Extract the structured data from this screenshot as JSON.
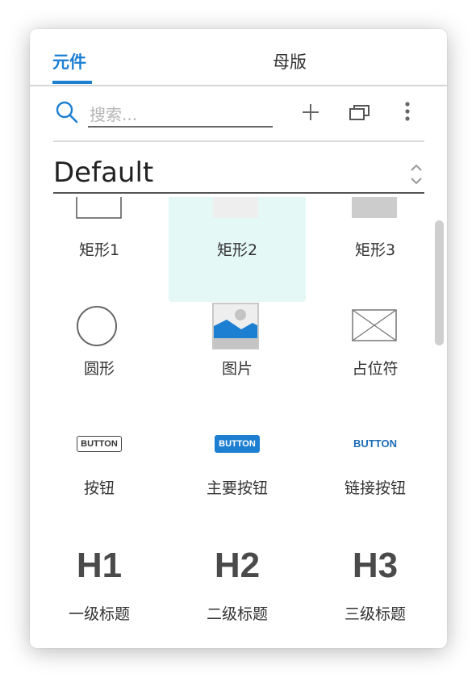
{
  "tabs": [
    {
      "label": "元件",
      "active": true
    },
    {
      "label": "母版",
      "active": false
    }
  ],
  "search": {
    "placeholder": "搜索...",
    "value": ""
  },
  "toolbar": {
    "icons": [
      "search-icon",
      "plus-icon",
      "duplicate-icon",
      "more-vertical-icon"
    ]
  },
  "library": {
    "selected": "Default"
  },
  "widgets": [
    {
      "label": "矩形1",
      "icon": "rectangle-outline-icon",
      "selected": false
    },
    {
      "label": "矩形2",
      "icon": "rectangle-light-fill-icon",
      "selected": true
    },
    {
      "label": "矩形3",
      "icon": "rectangle-gray-fill-icon",
      "selected": false
    },
    {
      "label": "圆形",
      "icon": "circle-icon",
      "selected": false
    },
    {
      "label": "图片",
      "icon": "image-icon",
      "selected": false
    },
    {
      "label": "占位符",
      "icon": "placeholder-icon",
      "selected": false
    },
    {
      "label": "按钮",
      "icon": "button-outline-icon",
      "icon_text": "BUTTON",
      "selected": false
    },
    {
      "label": "主要按钮",
      "icon": "button-primary-icon",
      "icon_text": "BUTTON",
      "selected": false
    },
    {
      "label": "链接按钮",
      "icon": "button-link-icon",
      "icon_text": "BUTTON",
      "selected": false
    },
    {
      "label": "一级标题",
      "icon": "h1-icon",
      "icon_text": "H1",
      "selected": false
    },
    {
      "label": "二级标题",
      "icon": "h2-icon",
      "icon_text": "H2",
      "selected": false
    },
    {
      "label": "三级标题",
      "icon": "h3-icon",
      "icon_text": "H3",
      "selected": false
    }
  ],
  "colors": {
    "accent": "#1d7fd2",
    "selected_bg": "#e4f8f6",
    "text": "#333333"
  }
}
